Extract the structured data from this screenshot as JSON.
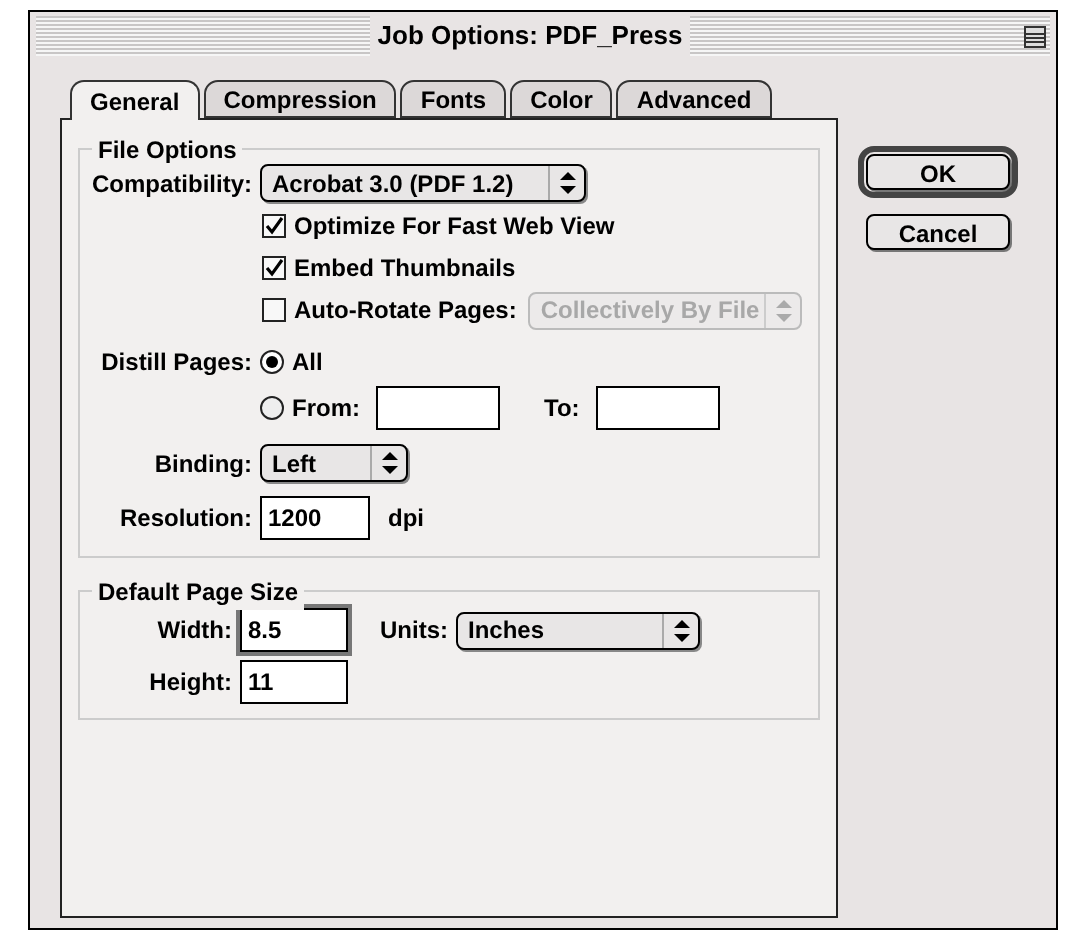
{
  "window": {
    "title": "Job Options: PDF_Press"
  },
  "tabs": [
    {
      "label": "General",
      "selected": true
    },
    {
      "label": "Compression",
      "selected": false
    },
    {
      "label": "Fonts",
      "selected": false
    },
    {
      "label": "Color",
      "selected": false
    },
    {
      "label": "Advanced",
      "selected": false
    }
  ],
  "buttons": [
    {
      "label": "OK",
      "default": true
    },
    {
      "label": "Cancel",
      "default": false
    }
  ],
  "file_options": {
    "title": "File Options",
    "compatibility": {
      "label": "Compatibility:",
      "value": "Acrobat 3.0 (PDF 1.2)"
    },
    "checkboxes": [
      {
        "label": "Optimize For Fast Web View",
        "checked": true
      },
      {
        "label": "Embed Thumbnails",
        "checked": true
      },
      {
        "label": "Auto-Rotate Pages:",
        "checked": false,
        "popup": {
          "value": "Collectively By File",
          "disabled": true
        }
      }
    ],
    "distill_pages": {
      "label": "Distill Pages:",
      "options": [
        {
          "label": "All",
          "selected": true,
          "kind": "plain"
        },
        {
          "label": "From:",
          "selected": false,
          "kind": "range",
          "to_label": "To:"
        }
      ]
    },
    "binding": {
      "label": "Binding:",
      "value": "Left"
    },
    "resolution": {
      "label": "Resolution:",
      "value": "1200",
      "unit": "dpi"
    }
  },
  "page_size": {
    "title": "Default Page Size",
    "width": {
      "label": "Width:",
      "value": "8.5",
      "focused": true
    },
    "units": {
      "label": "Units:",
      "value": "Inches"
    },
    "height": {
      "label": "Height:",
      "value": "11",
      "focused": false
    }
  }
}
